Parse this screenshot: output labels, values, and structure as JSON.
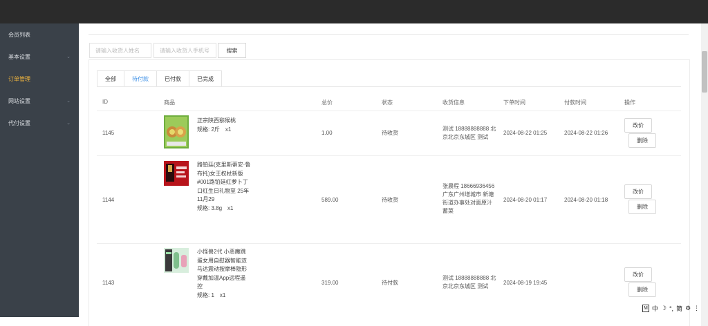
{
  "sidebar": {
    "items": [
      {
        "label": "会员列表",
        "chevron": false,
        "active": false
      },
      {
        "label": "基本设置",
        "chevron": true,
        "active": false
      },
      {
        "label": "订单管理",
        "chevron": false,
        "active": true
      },
      {
        "label": "网站设置",
        "chevron": true,
        "active": false
      },
      {
        "label": "代付设置",
        "chevron": true,
        "active": false
      }
    ]
  },
  "search": {
    "name_placeholder": "请输入收货人姓名",
    "phone_placeholder": "请输入收货人手机号",
    "button": "搜索"
  },
  "tabs": [
    "全部",
    "待付款",
    "已付款",
    "已完成"
  ],
  "active_tab": "待付款",
  "table": {
    "headers": {
      "id": "ID",
      "product": "商品",
      "total": "总价",
      "status": "状态",
      "receiver": "收货信息",
      "order_time": "下单时间",
      "pay_time": "付款时间",
      "action": "操作"
    },
    "rows": [
      {
        "id": "1145",
        "name": "正宗陕西猕猴桃",
        "spec": "规格: 2斤　x1",
        "total": "1.00",
        "status": "待收货",
        "receiver": "测试 18888888888 北京北京东城区 测试",
        "order_time": "2024-08-22 01:25",
        "pay_time": "2024-08-22 01:26",
        "btn_edit": "改价",
        "btn_delete": "删除"
      },
      {
        "id": "1144",
        "name": "路铂廷(克里斯蒂安·鲁布托)女王权杖新版#001路铂廷红萝卜丁口红生日礼物至 25年11月29",
        "spec": "规格: 3.8g　x1",
        "total": "589.00",
        "status": "待收货",
        "receiver": "张晨程 18666936456 广东广州增城市 新塘街道办事处对面原汁蓄菜",
        "order_time": "2024-08-20 01:17",
        "pay_time": "2024-08-20 01:18",
        "btn_edit": "改价",
        "btn_delete": "删除"
      },
      {
        "id": "1143",
        "name": "小怪兽2代 小恶魔跳蛋女用自慰器智能双马达震动按摩棒隐形穿戴加温App远程遥控",
        "spec": "规格: 1　x1",
        "total": "319.00",
        "status": "待付款",
        "receiver": "测试 18888888888 北京北京东城区 测试",
        "order_time": "2024-08-19 19:45",
        "pay_time": "",
        "btn_edit": "改价",
        "btn_delete": "删除"
      }
    ]
  },
  "ime_bar": {
    "m": "M",
    "zh": "中",
    "moon": "☽",
    "punct": "°,",
    "simp": "简",
    "gear": "⚙",
    "more": "⋮"
  }
}
